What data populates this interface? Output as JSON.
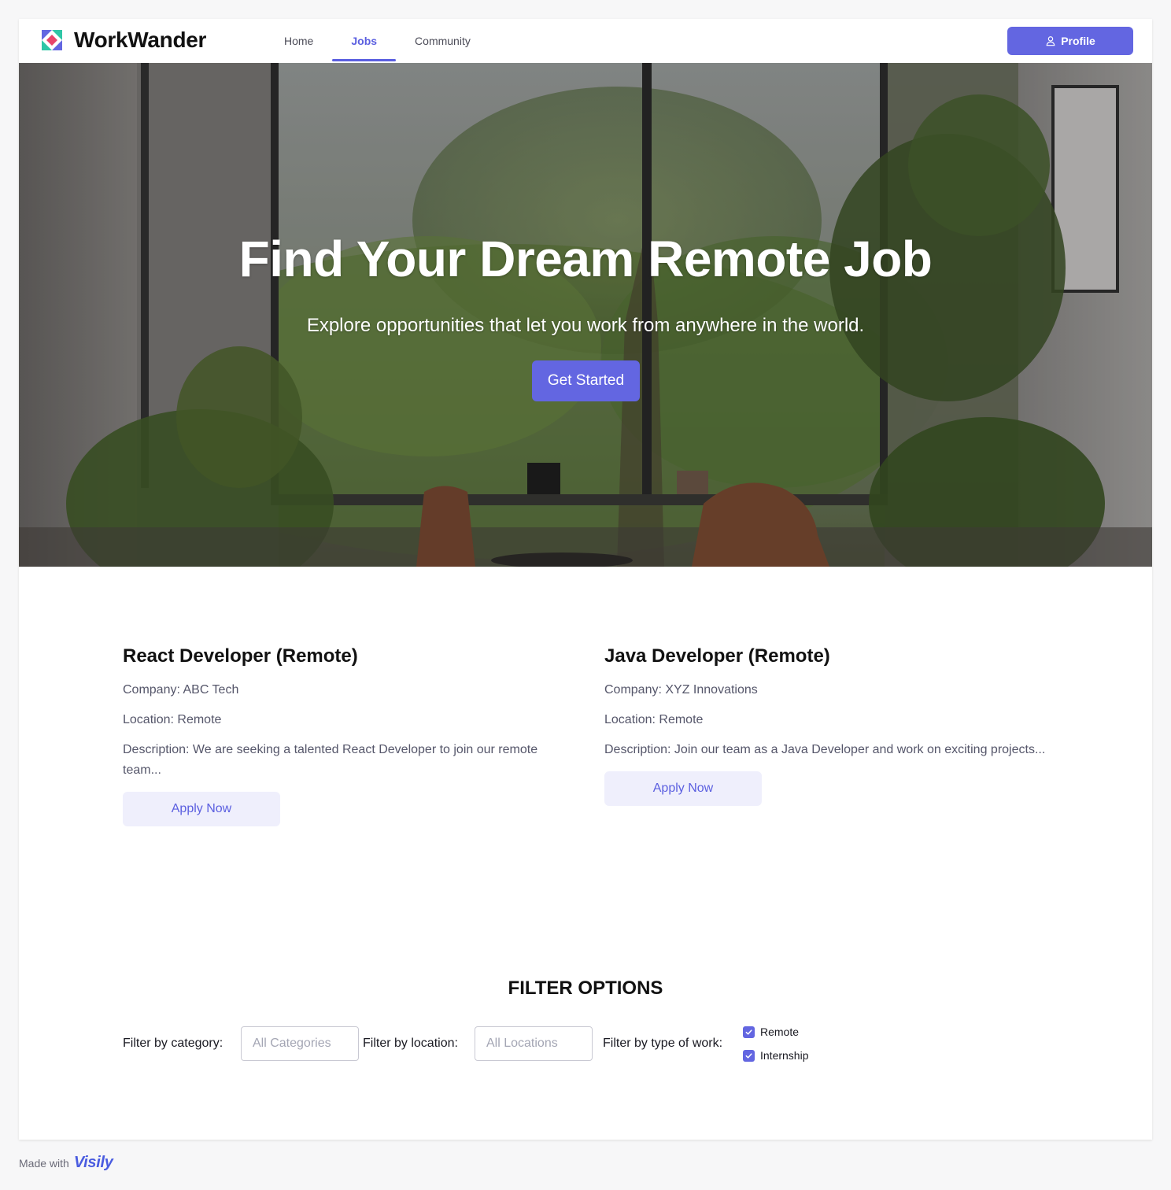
{
  "brand": {
    "name": "WorkWander",
    "logo_icon": "workwander-logo-icon"
  },
  "nav": {
    "tabs": [
      {
        "label": "Home",
        "active": false
      },
      {
        "label": "Jobs",
        "active": true
      },
      {
        "label": "Community",
        "active": false
      }
    ],
    "profile_label": "Profile",
    "profile_icon": "user-icon"
  },
  "hero": {
    "title": "Find Your Dream Remote Job",
    "subtitle": "Explore opportunities that let you work from anywhere in the world.",
    "cta_label": "Get Started"
  },
  "jobs": [
    {
      "title": "React Developer (Remote)",
      "company": "Company: ABC Tech",
      "location": "Location: Remote",
      "description": "Description: We are seeking a talented React Developer to join our remote team...",
      "apply_label": "Apply Now"
    },
    {
      "title": "Java Developer (Remote)",
      "company": "Company: XYZ Innovations",
      "location": "Location: Remote",
      "description": "Description: Join our team as a Java Developer and work on exciting projects...",
      "apply_label": "Apply Now"
    }
  ],
  "filters": {
    "heading": "FILTER OPTIONS",
    "category_label": "Filter by category:",
    "category_placeholder": "All Categories",
    "category_value": "",
    "location_label": "Filter by location:",
    "location_placeholder": "All Locations",
    "location_value": "",
    "type_label": "Filter by type of work:",
    "types": [
      {
        "label": "Remote",
        "checked": true
      },
      {
        "label": "Internship",
        "checked": true
      }
    ]
  },
  "footer": {
    "made_with": "Made with",
    "vendor": "Visily"
  },
  "colors": {
    "accent": "#6366e1",
    "accent_text": "#5b5fe0",
    "soft_accent_bg": "#efeffc",
    "muted_text": "#55566a"
  }
}
